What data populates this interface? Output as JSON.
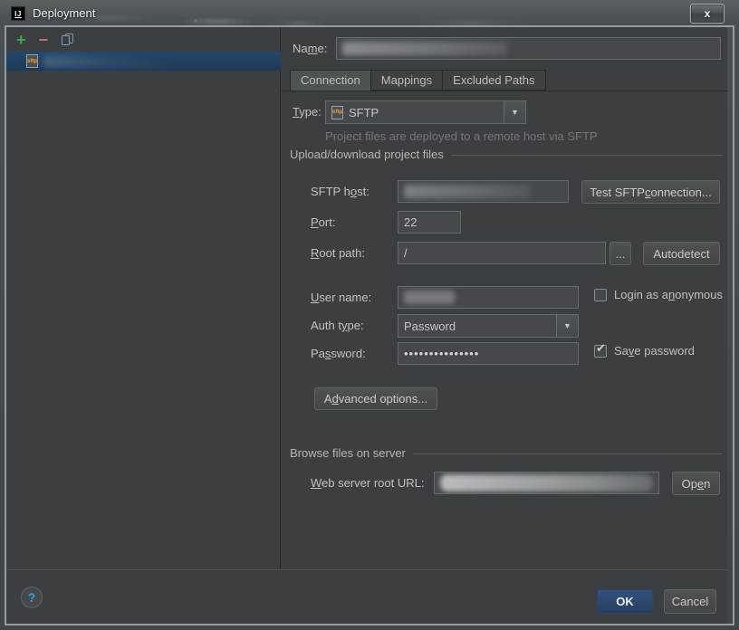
{
  "window": {
    "title": "Deployment"
  },
  "icons": {
    "logo_text": "IJ",
    "close_glyph": "x",
    "add_glyph": "+",
    "remove_glyph": "−",
    "sftp_badge": "sftp",
    "dropdown_glyph": "▼",
    "help_glyph": "?",
    "check_glyph": "✔"
  },
  "form": {
    "name_label": {
      "pre": "Na",
      "key": "m",
      "suf": "e:"
    },
    "tabs": [
      {
        "label": "Connection",
        "selected": true
      },
      {
        "label": "Mappings",
        "selected": false
      },
      {
        "label": "Excluded Paths",
        "selected": false
      }
    ],
    "type_label": {
      "pre": "",
      "key": "T",
      "suf": "ype:"
    },
    "type_value": "SFTP",
    "type_hint": "Project files are deployed to a remote host via SFTP",
    "section_upload": "Upload/download project files",
    "sftp_host_label": {
      "pre": "SFTP h",
      "key": "o",
      "suf": "st:"
    },
    "sftp_host_value": "",
    "test_connection_button": {
      "pre": "Test SFTP ",
      "key": "c",
      "suf": "onnection..."
    },
    "port_label": {
      "pre": "",
      "key": "P",
      "suf": "ort:"
    },
    "port_value": "22",
    "root_path_label": {
      "pre": "",
      "key": "R",
      "suf": "oot path:"
    },
    "root_path_value": "/",
    "browse_button": "...",
    "autodetect_button": "Autodetect",
    "user_name_label": {
      "pre": "",
      "key": "U",
      "suf": "ser name:"
    },
    "user_name_value": "",
    "anonymous_checkbox": {
      "pre": "Login as a",
      "key": "n",
      "suf": "onymous",
      "checked": false
    },
    "auth_type_label": {
      "pre": "Auth t",
      "key": "y",
      "suf": "pe:"
    },
    "auth_type_value": "Password",
    "password_label": {
      "pre": "Pa",
      "key": "s",
      "suf": "sword:"
    },
    "password_masked": "•••••••••••••••",
    "save_password_checkbox": {
      "pre": "Sa",
      "key": "v",
      "suf": "e password",
      "checked": true
    },
    "advanced_button": {
      "pre": "A",
      "key": "d",
      "suf": "vanced options..."
    },
    "section_browse": "Browse files on server",
    "web_url_label": {
      "pre": "",
      "key": "W",
      "suf": "eb server root URL:"
    },
    "web_url_value": "",
    "open_button": {
      "pre": "Op",
      "key": "e",
      "suf": "n"
    }
  },
  "footer": {
    "ok": "OK",
    "cancel": "Cancel"
  },
  "colors": {
    "dialog_bg": "#3c3f41",
    "input_bg": "#45494b",
    "input_border": "#646a6d",
    "selection_bg": "#1d3a57",
    "ok_button_bg": "#2d4b76",
    "add_icon": "#4aa44e",
    "remove_icon": "#c57470",
    "sftp_icon_accent": "#e8a33d",
    "hint_text": "#73767a",
    "help_question": "#3f9ed9"
  }
}
